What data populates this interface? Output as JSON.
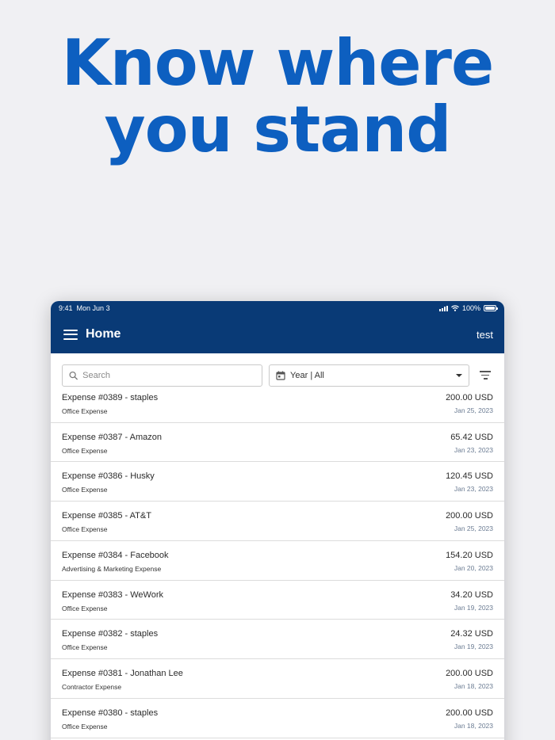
{
  "headline": {
    "line1": "Know where",
    "line2": "you stand"
  },
  "statusbar": {
    "time": "9:41",
    "date": "Mon Jun 3",
    "battery": "100%"
  },
  "appbar": {
    "title": "Home",
    "user": "test"
  },
  "search": {
    "placeholder": "Search",
    "value": ""
  },
  "period_select": {
    "selected": "Year | All"
  },
  "colors": {
    "brand_blue": "#0d5fc0",
    "header_navy": "#093a76"
  },
  "icons": [
    "menu-icon",
    "search-icon",
    "calendar-icon",
    "chevron-down-icon",
    "filter-icon",
    "signal-icon",
    "wifi-icon",
    "battery-icon"
  ],
  "expenses": [
    {
      "title": "Expense #0389 - staples",
      "category": "Office Expense",
      "amount": "200.00  USD",
      "date": "Jan 25, 2023"
    },
    {
      "title": "Expense #0387 - Amazon",
      "category": "Office Expense",
      "amount": "65.42  USD",
      "date": "Jan 23, 2023"
    },
    {
      "title": "Expense #0386 - Husky",
      "category": "Office Expense",
      "amount": "120.45  USD",
      "date": "Jan 23, 2023"
    },
    {
      "title": "Expense #0385 - AT&T",
      "category": "Office Expense",
      "amount": "200.00  USD",
      "date": "Jan 25, 2023"
    },
    {
      "title": "Expense #0384 - Facebook",
      "category": "Advertising & Marketing Expense",
      "amount": "154.20  USD",
      "date": "Jan 20, 2023"
    },
    {
      "title": "Expense #0383 - WeWork",
      "category": "Office Expense",
      "amount": "34.20  USD",
      "date": "Jan 19, 2023"
    },
    {
      "title": "Expense #0382 - staples",
      "category": "Office Expense",
      "amount": "24.32  USD",
      "date": "Jan 19, 2023"
    },
    {
      "title": "Expense #0381 - Jonathan Lee",
      "category": "Contractor Expense",
      "amount": "200.00  USD",
      "date": "Jan 18, 2023"
    },
    {
      "title": "Expense #0380 - staples",
      "category": "Office Expense",
      "amount": "200.00  USD",
      "date": "Jan 18, 2023"
    }
  ]
}
